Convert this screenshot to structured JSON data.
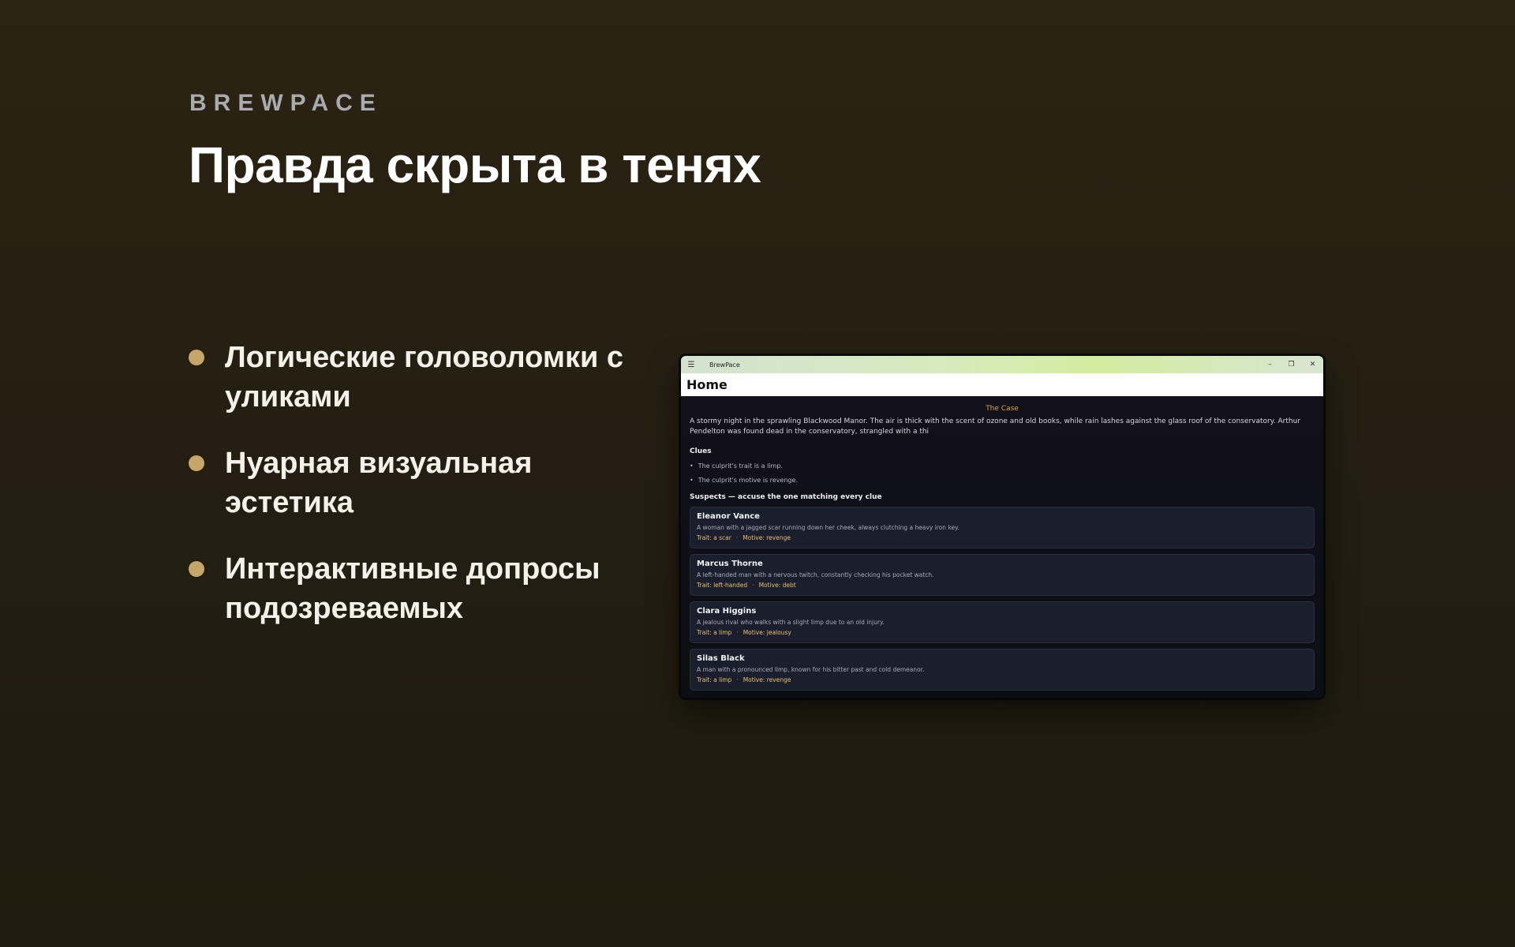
{
  "slide": {
    "brand": "BREWPACE",
    "headline": "Правда скрыта в тенях",
    "bullets": [
      "Логические головоломки с уликами",
      "Нуарная визуальная эстетика",
      "Интерактивные допросы подозреваемых"
    ]
  },
  "window": {
    "title": "BrewPace",
    "page_title": "Home",
    "case": {
      "heading": "The Case",
      "text": "A stormy night in the sprawling Blackwood Manor. The air is thick with the scent of ozone and old books, while rain lashes against the glass roof of the conservatory. Arthur Pendelton was found dead in the conservatory, strangled with a thi"
    },
    "clues_heading": "Clues",
    "clues": [
      "The culprit's trait is a limp.",
      "The culprit's motive is revenge."
    ],
    "suspects_heading": "Suspects — accuse the one matching every clue",
    "suspects": [
      {
        "name": "Eleanor Vance",
        "desc": "A woman with a jagged scar running down her cheek, always clutching a heavy iron key.",
        "trait": "Trait: a scar",
        "motive": "Motive: revenge"
      },
      {
        "name": "Marcus Thorne",
        "desc": "A left-handed man with a nervous twitch, constantly checking his pocket watch.",
        "trait": "Trait: left-handed",
        "motive": "Motive: debt"
      },
      {
        "name": "Clara Higgins",
        "desc": "A jealous rival who walks with a slight limp due to an old injury.",
        "trait": "Trait: a limp",
        "motive": "Motive: jealousy"
      },
      {
        "name": "Silas Black",
        "desc": "A man with a pronounced limp, known for his bitter past and cold demeanor.",
        "trait": "Trait: a limp",
        "motive": "Motive: revenge"
      }
    ],
    "separator": "·"
  }
}
